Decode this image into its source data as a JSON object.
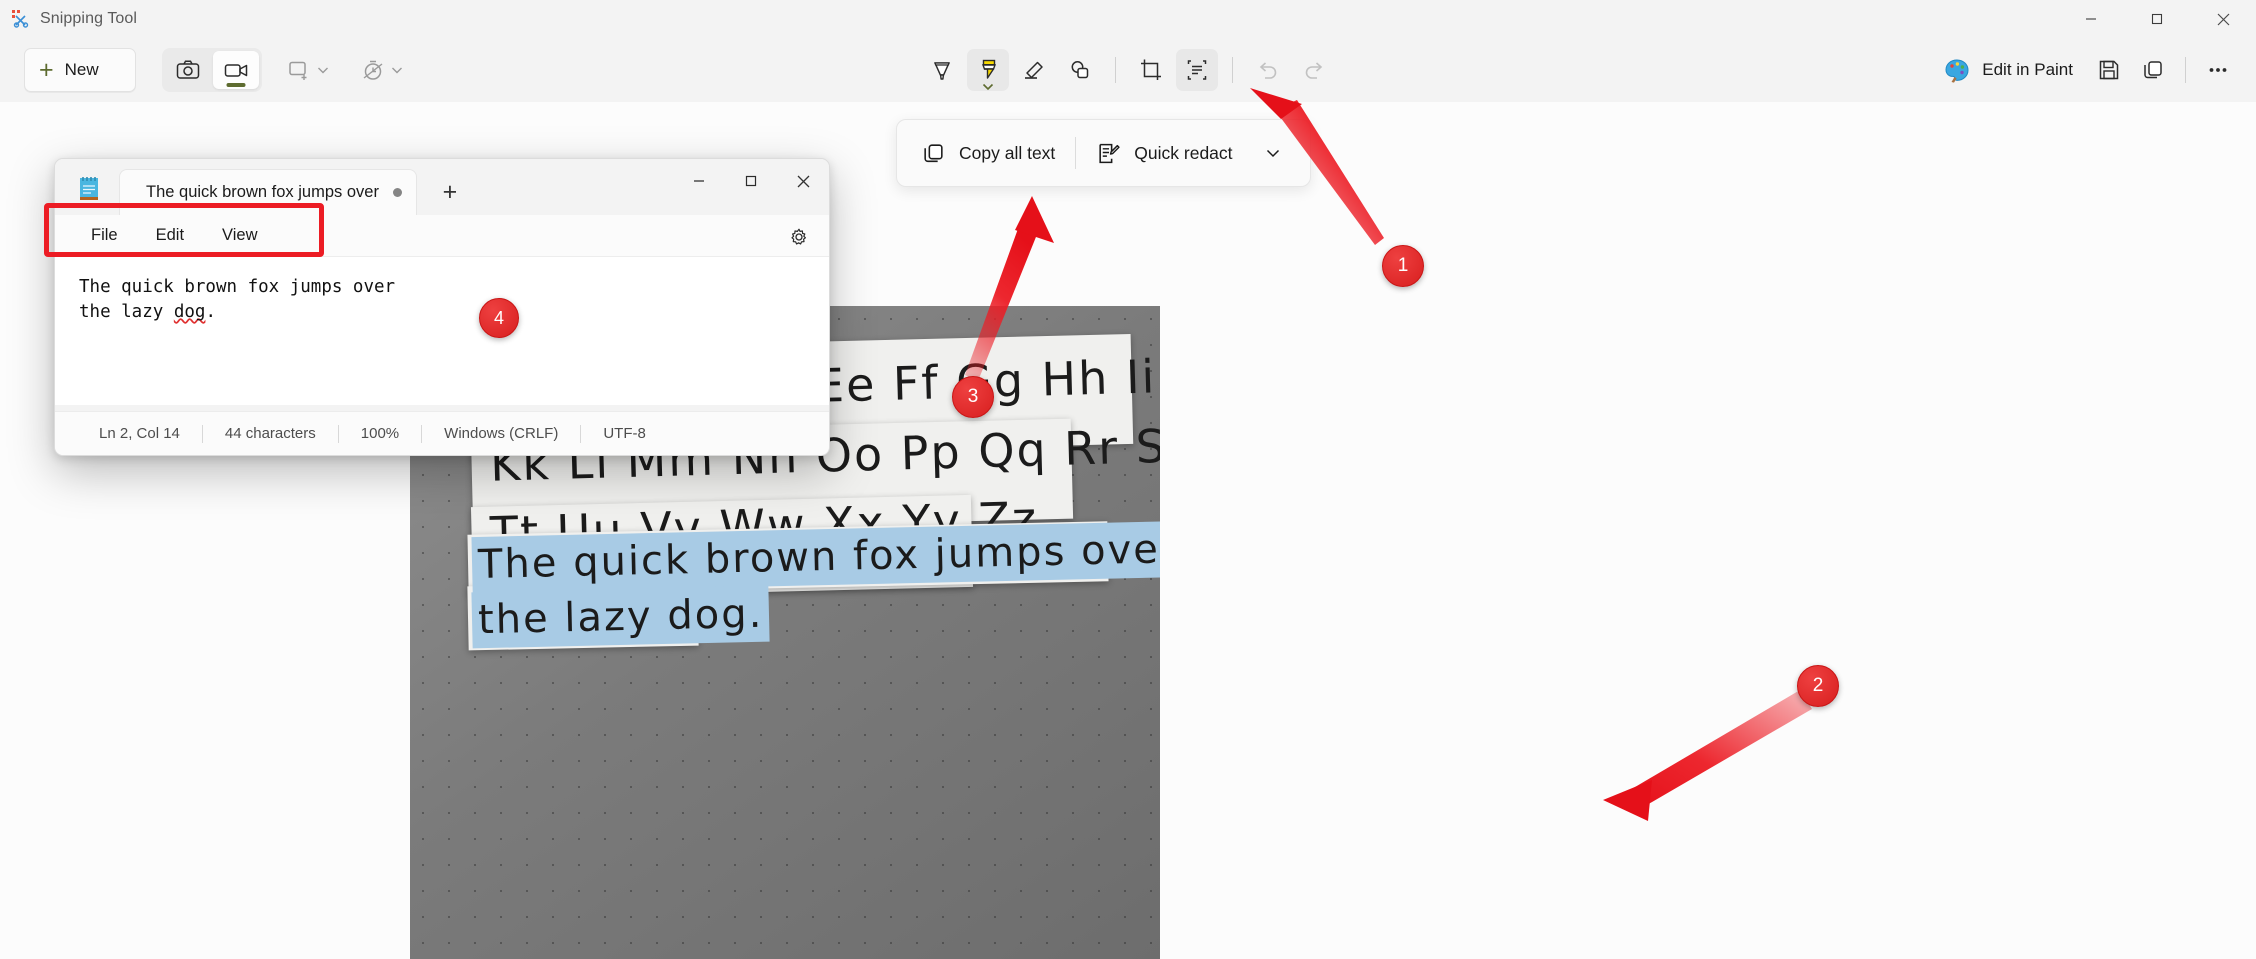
{
  "app": {
    "title": "Snipping Tool",
    "icon": "snipping-tool-icon"
  },
  "window_controls": {
    "minimize": "—",
    "maximize": "☐",
    "close": "✕"
  },
  "toolbar": {
    "new_button": {
      "label": "New",
      "icon": "plus-icon"
    },
    "modes": [
      {
        "name": "snapshot",
        "icon": "camera-icon",
        "selected": false
      },
      {
        "name": "record",
        "icon": "video-camera-icon",
        "selected": true
      }
    ],
    "shape_split": {
      "icon": "rectangle-snip-icon",
      "caret": "chevron-down-icon"
    },
    "delay_split": {
      "icon": "timer-icon",
      "caret": "chevron-down-icon"
    },
    "tools": [
      {
        "name": "ballpoint-pen",
        "icon": "ballpoint-pen-icon",
        "selected": false,
        "disabled": false
      },
      {
        "name": "highlighter",
        "icon": "highlighter-icon",
        "selected": true,
        "disabled": false,
        "color": "#f7d900"
      },
      {
        "name": "eraser",
        "icon": "eraser-icon",
        "selected": false,
        "disabled": false
      },
      {
        "name": "shapes",
        "icon": "shapes-icon",
        "selected": false,
        "disabled": false
      },
      {
        "name": "crop",
        "icon": "crop-icon",
        "selected": false,
        "disabled": false
      },
      {
        "name": "text-actions",
        "icon": "text-actions-icon",
        "selected": true,
        "disabled": false
      },
      {
        "name": "undo",
        "icon": "undo-icon",
        "selected": false,
        "disabled": true
      },
      {
        "name": "redo",
        "icon": "redo-icon",
        "selected": false,
        "disabled": true
      }
    ],
    "edit_in_paint": {
      "label": "Edit in Paint",
      "icon": "paint-palette-icon"
    },
    "save": {
      "icon": "save-icon"
    },
    "copy": {
      "icon": "copy-icon"
    },
    "more": {
      "icon": "more-options-icon"
    }
  },
  "text_actions_flyout": {
    "copy_all_text": {
      "label": "Copy all text",
      "icon": "copy-icon"
    },
    "quick_redact": {
      "label": "Quick redact",
      "icon": "redact-edit-icon",
      "caret": "chevron-down-icon"
    }
  },
  "notepad": {
    "icon": "notepad-icon",
    "tab": {
      "label": "The quick brown fox jumps over",
      "modified_dot": "●"
    },
    "new_tab": "+",
    "window_controls": {
      "minimize": "—",
      "maximize": "□",
      "close": "✕"
    },
    "menu": [
      "File",
      "Edit",
      "View"
    ],
    "settings_icon": "gear-icon",
    "content": {
      "line1": "The quick brown fox jumps over",
      "line2_prefix": "the lazy ",
      "line2_misspelled": "dog",
      "line2_suffix": "."
    },
    "status": [
      "Ln 2, Col 14",
      "44 characters",
      "100%",
      "Windows (CRLF)",
      "UTF-8"
    ]
  },
  "snip_image": {
    "description": "photo of handwritten alphabet and sentence on paper against a gray dotted board",
    "alphabet_rows": [
      "Aa Bb Cc Dd Ee Ff Gg Hh Ii Jj",
      "Kk Ll Mm Nn Oo Pp Qq Rr Ss",
      "Tt Uu Vv Ww Xx Yy Zz"
    ],
    "sentence_line1": "The quick brown fox jumps over",
    "sentence_line2": "the lazy dog.",
    "selection_color": "#a8cbe5"
  },
  "annotations": {
    "accent_color": "#ec1c24",
    "badges": [
      {
        "id": "1",
        "label": "1",
        "target": "text-actions-toolbar-button"
      },
      {
        "id": "2",
        "label": "2",
        "target": "selected-handwritten-text"
      },
      {
        "id": "3",
        "label": "3",
        "target": "copy-all-text-button"
      },
      {
        "id": "4",
        "label": "4",
        "target": "notepad-pasted-text"
      }
    ]
  }
}
